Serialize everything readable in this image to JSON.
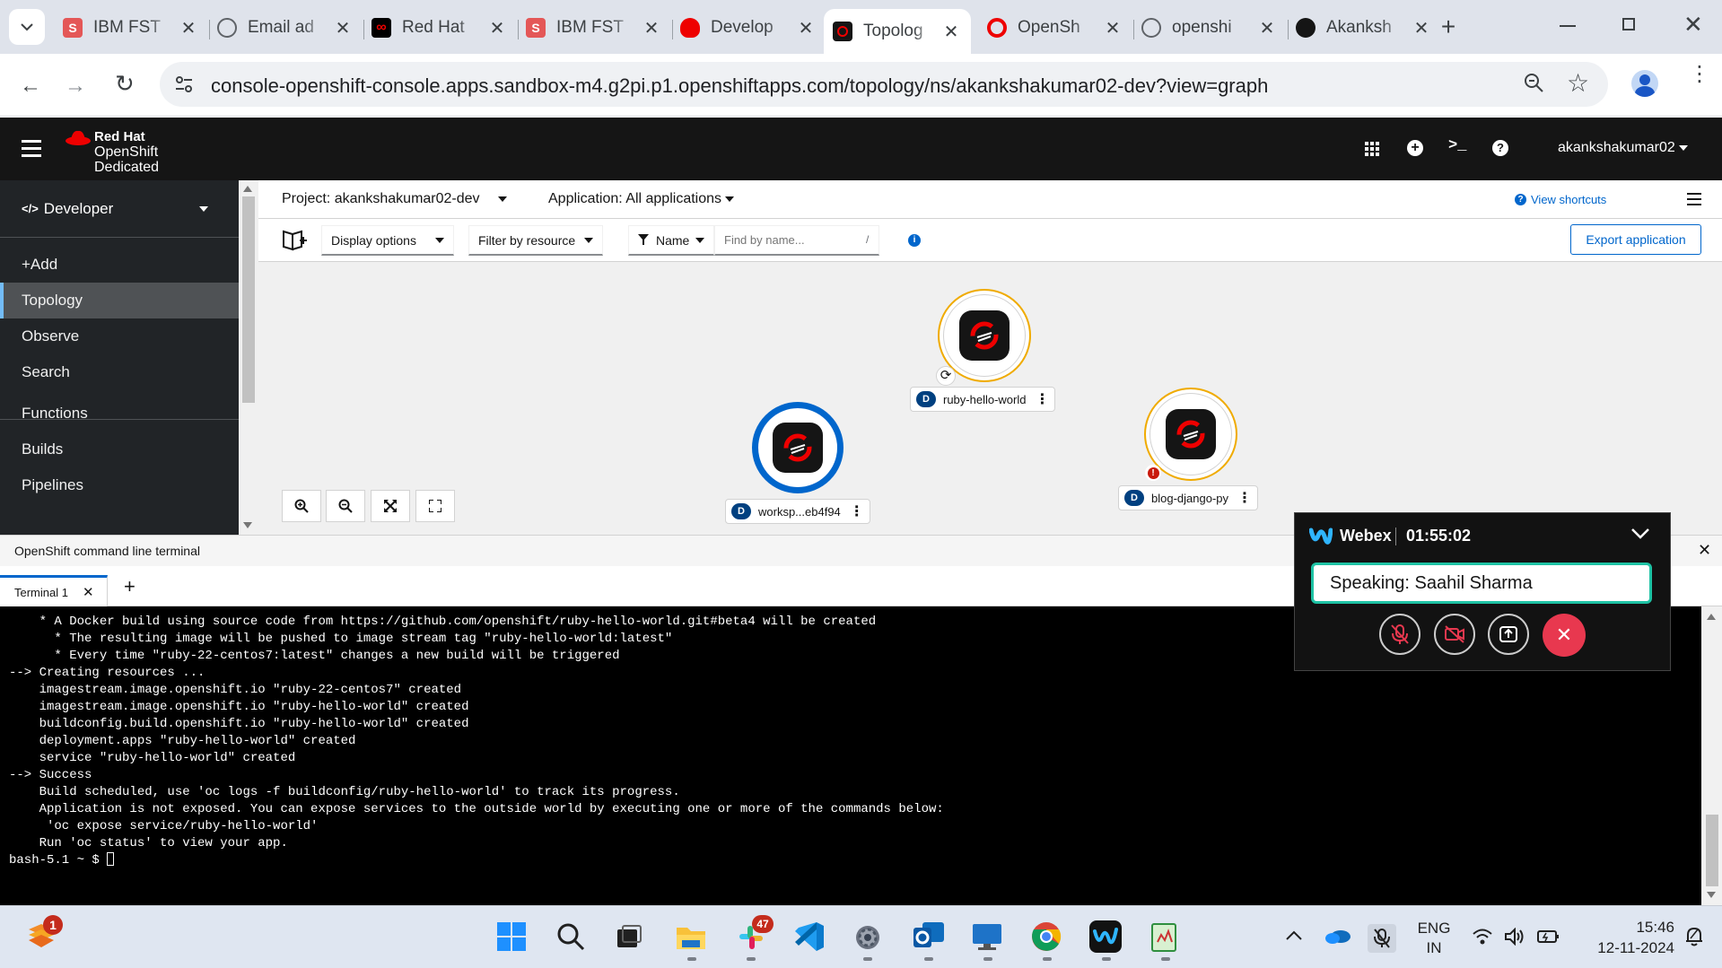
{
  "browser": {
    "tabs": [
      {
        "title": "IBM FST",
        "favicon": "s-icon",
        "color": "#e45757"
      },
      {
        "title": "Email ad",
        "favicon": "globe-icon",
        "color": "#5f6368"
      },
      {
        "title": "Red Hat",
        "favicon": "infinity-icon",
        "color": "#000000"
      },
      {
        "title": "IBM FST",
        "favicon": "s-icon",
        "color": "#e45757"
      },
      {
        "title": "Develop",
        "favicon": "redhat-icon",
        "color": "#ee0000"
      },
      {
        "title": "Topolog",
        "favicon": "openshift-icon",
        "color": "#151515"
      },
      {
        "title": "OpenSh",
        "favicon": "openshift-sync-icon",
        "color": "#ee0000"
      },
      {
        "title": "openshi",
        "favicon": "globe-icon",
        "color": "#5f6368"
      },
      {
        "title": "Akanksh",
        "favicon": "github-icon",
        "color": "#151515"
      }
    ],
    "url": "console-openshift-console.apps.sandbox-m4.g2pi.p1.openshiftapps.com/topology/ns/akankshakumar02-dev?view=graph"
  },
  "masthead": {
    "brand_line1": "Red Hat",
    "brand_line2": "OpenShift",
    "brand_line3": "Dedicated",
    "user": "akankshakumar02"
  },
  "sidebar": {
    "perspective": "Developer",
    "items": [
      {
        "label": "+Add",
        "active": false
      },
      {
        "label": "Topology",
        "active": true
      },
      {
        "label": "Observe",
        "active": false
      },
      {
        "label": "Search",
        "active": false
      },
      {
        "label": "Functions",
        "active": false
      },
      {
        "label": "Builds",
        "active": false
      },
      {
        "label": "Pipelines",
        "active": false
      }
    ]
  },
  "projectbar": {
    "project": "Project: akankshakumar02-dev",
    "application": "Application: All applications",
    "view_shortcuts": "View shortcuts"
  },
  "toolbar": {
    "display_options": "Display options",
    "filter_by_resource": "Filter by resource",
    "name_filter": "Name",
    "find_placeholder": "Find by name...",
    "slash_hint": "/",
    "export": "Export application"
  },
  "nodes": {
    "ruby": {
      "badge": "D",
      "label": "ruby-hello-world"
    },
    "workspace": {
      "badge": "D",
      "label": "worksp...eb4f94"
    },
    "blog": {
      "badge": "D",
      "label": "blog-django-py"
    }
  },
  "terminal": {
    "title": "OpenShift command line terminal",
    "tab": "Terminal 1",
    "lines": [
      "    * A Docker build using source code from https://github.com/openshift/ruby-hello-world.git#beta4 will be created",
      "      * The resulting image will be pushed to image stream tag \"ruby-hello-world:latest\"",
      "      * Every time \"ruby-22-centos7:latest\" changes a new build will be triggered",
      "",
      "--> Creating resources ...",
      "    imagestream.image.openshift.io \"ruby-22-centos7\" created",
      "    imagestream.image.openshift.io \"ruby-hello-world\" created",
      "    buildconfig.build.openshift.io \"ruby-hello-world\" created",
      "    deployment.apps \"ruby-hello-world\" created",
      "    service \"ruby-hello-world\" created",
      "--> Success",
      "    Build scheduled, use 'oc logs -f buildconfig/ruby-hello-world' to track its progress.",
      "    Application is not exposed. You can expose services to the outside world by executing one or more of the commands below:",
      "     'oc expose service/ruby-hello-world'",
      "    Run 'oc status' to view your app.",
      "bash-5.1 ~ $ "
    ]
  },
  "webex": {
    "app": "Webex",
    "timer": "01:55:02",
    "speaking": "Speaking: Saahil Sharma"
  },
  "taskbar": {
    "notification_count": "1",
    "slack_count": "47",
    "lang1": "ENG",
    "lang2": "IN",
    "time": "15:46",
    "date": "12-11-2024"
  }
}
